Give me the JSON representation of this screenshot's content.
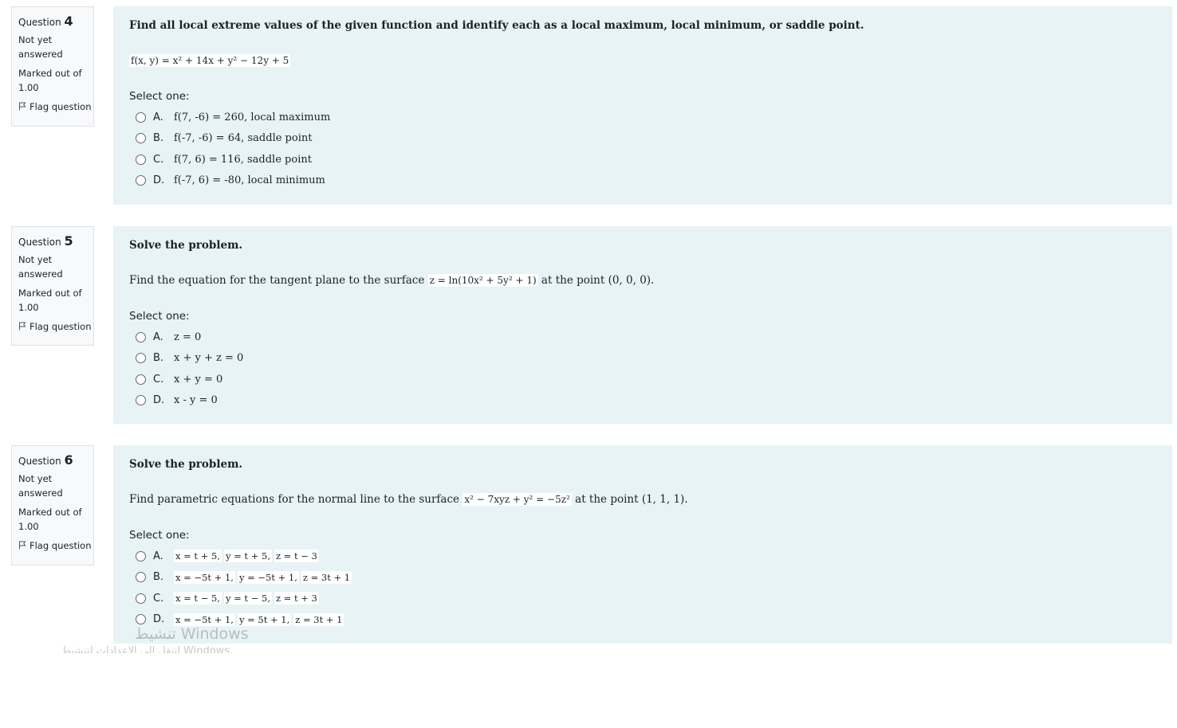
{
  "questions": [
    {
      "label": "Question",
      "number": "4",
      "state": "Not yet answered",
      "grade": "Marked out of 1.00",
      "flag": "Flag question",
      "qtext": "Find all local extreme values of the given function and identify each as a local maximum, local minimum, or saddle point.",
      "statement_parts": [
        "",
        "f(x, y) = x² + 14x + y² − 12y + 5",
        ""
      ],
      "prompt": "Select one:",
      "options": [
        {
          "letter": "A.",
          "text": "f(7, -6) = 260, local maximum"
        },
        {
          "letter": "B.",
          "text": "f(-7, -6) = 64, saddle point"
        },
        {
          "letter": "C.",
          "text": "f(7, 6) = 116, saddle point"
        },
        {
          "letter": "D.",
          "text": "f(-7, 6) = -80, local minimum"
        }
      ]
    },
    {
      "label": "Question",
      "number": "5",
      "state": "Not yet answered",
      "grade": "Marked out of 1.00",
      "flag": "Flag question",
      "qtext": "Solve the problem.",
      "statement_parts": [
        "Find the equation for the tangent plane to the surface ",
        "z = ln(10x² + 5y² + 1)",
        " at the point (0, 0, 0)."
      ],
      "prompt": "Select one:",
      "options": [
        {
          "letter": "A.",
          "text": "z = 0"
        },
        {
          "letter": "B.",
          "text": "x + y + z = 0"
        },
        {
          "letter": "C.",
          "text": "x + y = 0"
        },
        {
          "letter": "D.",
          "text": "x - y = 0"
        }
      ]
    },
    {
      "label": "Question",
      "number": "6",
      "state": "Not yet answered",
      "grade": "Marked out of 1.00",
      "flag": "Flag question",
      "qtext": "Solve the problem.",
      "statement_parts": [
        "Find parametric equations for the normal line to the surface ",
        "x² − 7xyz + y² = −5z²",
        " at the point (1, 1, 1)."
      ],
      "prompt": "Select one:",
      "options": [
        {
          "letter": "A.",
          "parts": [
            "x = t + 5,",
            "y = t + 5,",
            "z = t − 3"
          ]
        },
        {
          "letter": "B.",
          "parts": [
            "x = −5t + 1,",
            "y = −5t + 1,",
            "z = 3t + 1"
          ]
        },
        {
          "letter": "C.",
          "parts": [
            "x = t − 5,",
            "y = t − 5,",
            "z = t + 3"
          ]
        },
        {
          "letter": "D.",
          "parts": [
            "x = −5t + 1,",
            "y = 5t + 1,",
            "z = 3t + 1"
          ]
        }
      ]
    }
  ],
  "watermark": {
    "line1": "تنشيط Windows",
    "line2": "انتقل إلى الإعدادات لتنشيط Windows."
  }
}
